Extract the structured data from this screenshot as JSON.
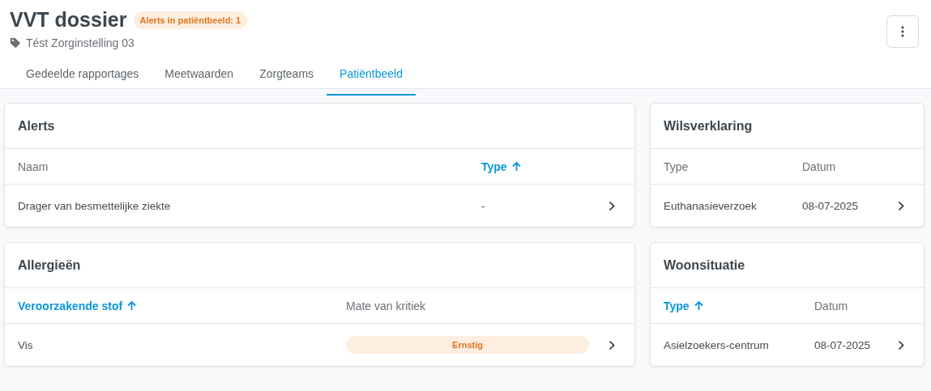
{
  "header": {
    "title": "VVT dossier",
    "badge": "Alerts in patiëntbeeld: 1",
    "organisation": "Tést Zorginstelling 03"
  },
  "tabs": [
    {
      "label": "Gedeelde rapportages",
      "selected": false
    },
    {
      "label": "Meetwaarden",
      "selected": false
    },
    {
      "label": "Zorgteams",
      "selected": false
    },
    {
      "label": "Patiëntbeeld",
      "selected": true
    }
  ],
  "cards": [
    {
      "title": "Alerts",
      "columns": [
        {
          "label": "Naam",
          "sorted": false
        },
        {
          "label": "Type",
          "sorted": true
        }
      ],
      "rows": [
        {
          "cells": [
            {
              "kind": "text",
              "text": "Drager van besmettelijke ziekte"
            },
            {
              "kind": "text",
              "text": "-"
            }
          ]
        }
      ]
    },
    {
      "title": "Wilsverklaring",
      "columns": [
        {
          "label": "Type",
          "sorted": false
        },
        {
          "label": "Datum",
          "sorted": false
        }
      ],
      "rows": [
        {
          "cells": [
            {
              "kind": "text",
              "text": "Euthanasieverzoek"
            },
            {
              "kind": "text",
              "text": "08-07-2025"
            }
          ]
        }
      ]
    },
    {
      "title": "Allergieën",
      "columns": [
        {
          "label": "Veroorzakende stof",
          "sorted": true
        },
        {
          "label": "Mate van kritiek",
          "sorted": false
        }
      ],
      "rows": [
        {
          "cells": [
            {
              "kind": "text",
              "text": "Vis"
            },
            {
              "kind": "badge",
              "text": "Ernstig"
            }
          ]
        }
      ]
    },
    {
      "title": "Woonsituatie",
      "columns": [
        {
          "label": "Type",
          "sorted": true
        },
        {
          "label": "Datum",
          "sorted": false
        }
      ],
      "rows": [
        {
          "cells": [
            {
              "kind": "text",
              "text": "Asielzoekers-centrum"
            },
            {
              "kind": "text",
              "text": "08-07-2025"
            }
          ]
        }
      ]
    }
  ]
}
